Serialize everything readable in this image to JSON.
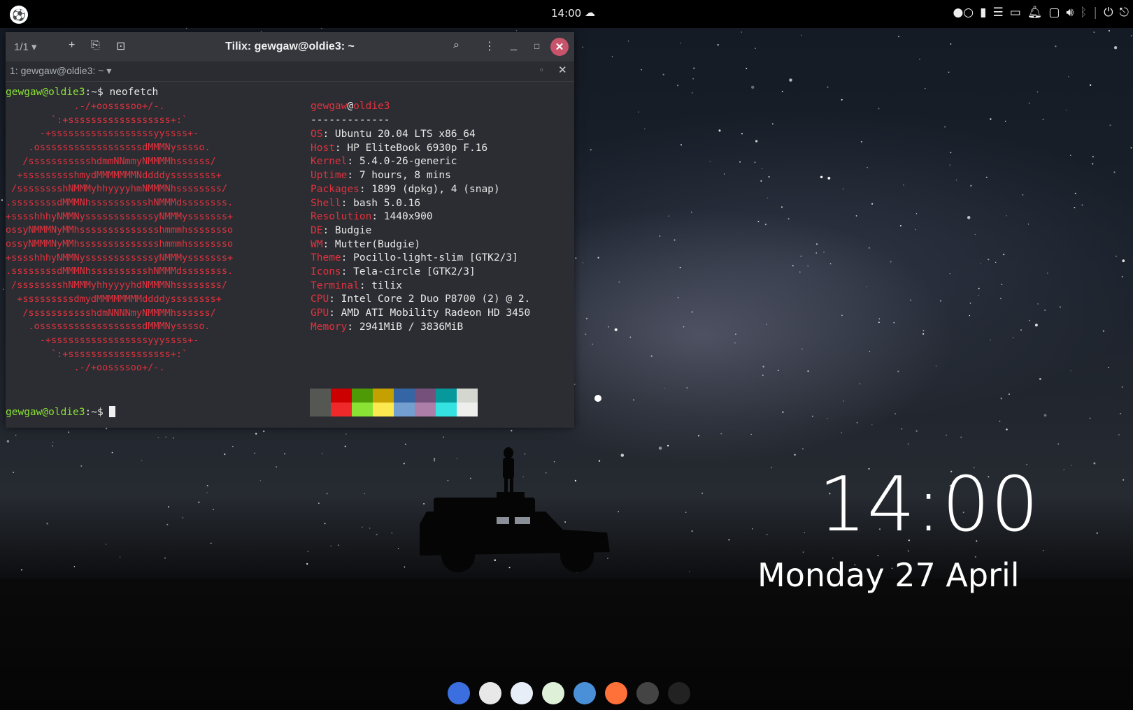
{
  "panel": {
    "clock": "14:00",
    "weather_icon": "cloud-icon",
    "tray_icons": [
      "dots-icon",
      "notes-icon",
      "menu-icon",
      "folder-icon",
      "bell-icon",
      "display-icon",
      "volume-icon",
      "bluetooth-icon",
      "power-icon",
      "logout-icon"
    ]
  },
  "terminal": {
    "session_counter": "1/1 ▾",
    "title": "Tilix: gewgaw@oldie3: ~",
    "tab_title": "1: gewgaw@oldie3: ~ ▾",
    "prompt_user": "gewgaw@oldie3",
    "prompt_suffix": ":~$",
    "command": "neofetch",
    "header_user": "gewgaw",
    "header_at": "@",
    "header_host": "oldie3",
    "separator": "-------------",
    "info": [
      {
        "key": "OS",
        "value": ": Ubuntu 20.04 LTS x86_64"
      },
      {
        "key": "Host",
        "value": ": HP EliteBook 6930p F.16"
      },
      {
        "key": "Kernel",
        "value": ": 5.4.0-26-generic"
      },
      {
        "key": "Uptime",
        "value": ": 7 hours, 8 mins"
      },
      {
        "key": "Packages",
        "value": ": 1899 (dpkg), 4 (snap)"
      },
      {
        "key": "Shell",
        "value": ": bash 5.0.16"
      },
      {
        "key": "Resolution",
        "value": ": 1440x900"
      },
      {
        "key": "DE",
        "value": ": Budgie"
      },
      {
        "key": "WM",
        "value": ": Mutter(Budgie)"
      },
      {
        "key": "Theme",
        "value": ": Pocillo-light-slim [GTK2/3]"
      },
      {
        "key": "Icons",
        "value": ": Tela-circle [GTK2/3]"
      },
      {
        "key": "Terminal",
        "value": ": tilix"
      },
      {
        "key": "CPU",
        "value": ": Intel Core 2 Duo P8700 (2) @ 2."
      },
      {
        "key": "GPU",
        "value": ": AMD ATI Mobility Radeon HD 3450"
      },
      {
        "key": "Memory",
        "value": ": 2941MiB / 3836MiB"
      }
    ],
    "logo": [
      "            .-/+oossssoo+/-.",
      "        `:+ssssssssssssssssss+:`",
      "      -+ssssssssssssssssssyyssss+-",
      "    .ossssssssssssssssssdMMMNysssso.",
      "   /ssssssssssshdmmNNmmyNMMMMhssssss/",
      "  +ssssssssshmydMMMMMMMNddddyssssssss+",
      " /sssssssshNMMMyhhyyyyhmNMMMNhssssssss/",
      ".ssssssssdMMMNhsssssssssshNMMMdssssssss.",
      "+sssshhhyNMMNyssssssssssssyNMMMysssssss+",
      "ossyNMMMNyMMhsssssssssssssshmmmhssssssso",
      "ossyNMMMNyMMhsssssssssssssshmmmhssssssso",
      "+sssshhhyNMMNyssssssssssssyNMMMysssssss+",
      ".ssssssssdMMMNhsssssssssshNMMMdssssssss.",
      " /sssssssshNMMMyhhyyyyhdNMMMNhssssssss/",
      "  +sssssssssdmydMMMMMMMMddddyssssssss+",
      "   /ssssssssssshdmNNNNmyNMMMMhssssss/",
      "    .ossssssssssssssssssdMMMNysssso.",
      "      -+sssssssssssssssssyyyssss+-",
      "        `:+ssssssssssssssssss+:`",
      "            .-/+oossssoo+/-."
    ],
    "colors_top": [
      "#555753",
      "#cc0000",
      "#4e9a06",
      "#c4a000",
      "#3465a4",
      "#75507b",
      "#06989a",
      "#d3d7cf"
    ],
    "colors_bottom": [
      "#555753",
      "#ef2929",
      "#8ae234",
      "#fce94f",
      "#729fcf",
      "#ad7fa8",
      "#34e2e2",
      "#eeeeec"
    ]
  },
  "desktop": {
    "clock": "14:00",
    "date": "Monday 27 April"
  },
  "dock": {
    "icons": [
      {
        "name": "budgie-menu-icon",
        "color": "#3b6fe0"
      },
      {
        "name": "rhythmbox-icon",
        "color": "#e8e8e8"
      },
      {
        "name": "files-icon",
        "color": "#e8eef8"
      },
      {
        "name": "text-editor-icon",
        "color": "#dff0d8"
      },
      {
        "name": "settings-icon",
        "color": "#4a90d9"
      },
      {
        "name": "firefox-icon",
        "color": "#ff7139"
      },
      {
        "name": "terminal-icon",
        "color": "#444444"
      },
      {
        "name": "trash-icon",
        "color": "#222222"
      }
    ]
  }
}
